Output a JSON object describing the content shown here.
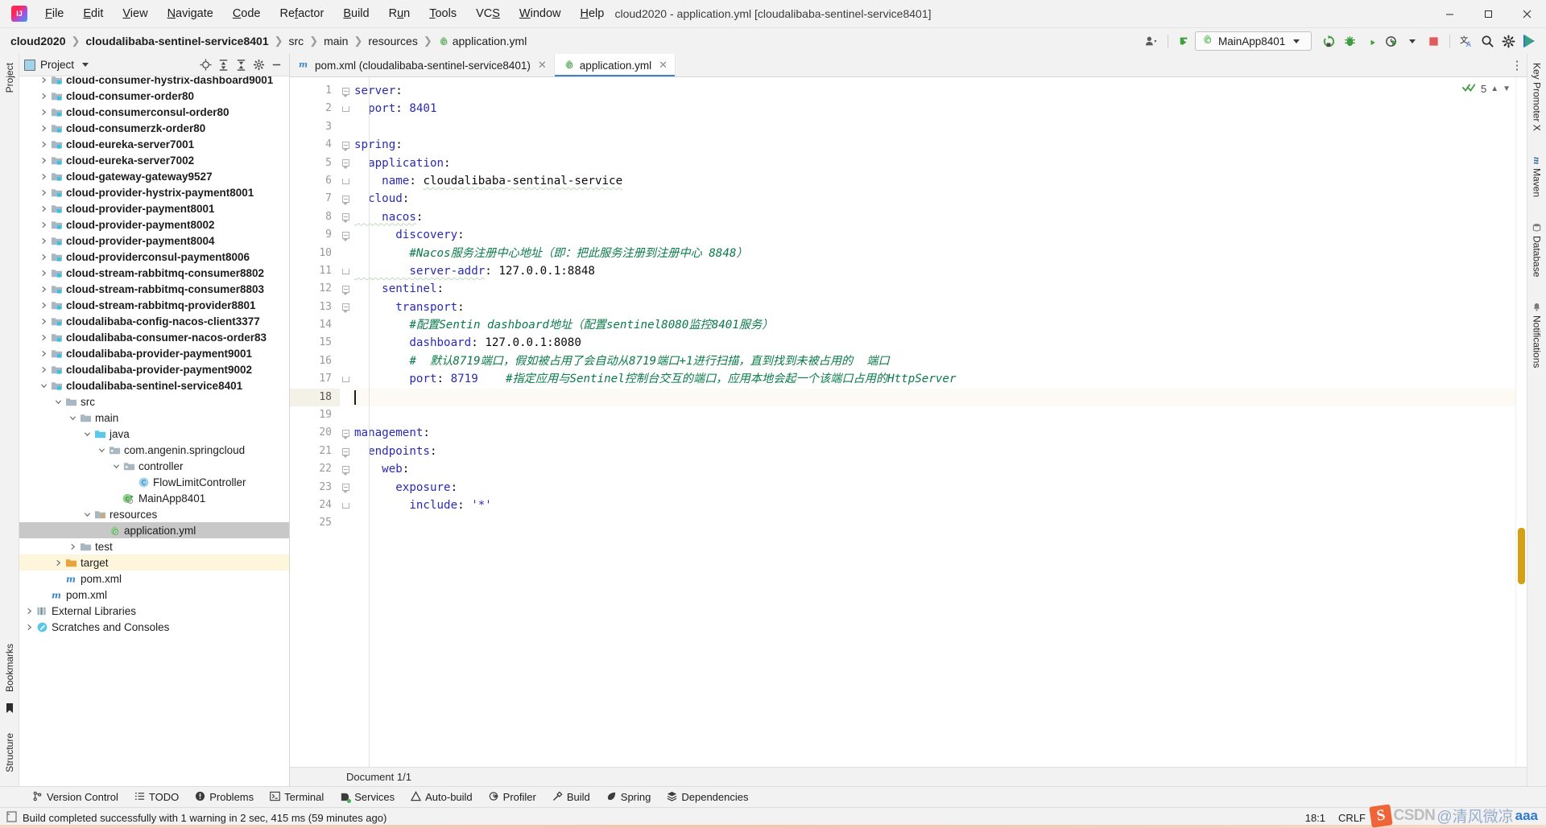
{
  "window": {
    "title": "cloud2020 - application.yml [cloudalibaba-sentinel-service8401]",
    "minimize": "—",
    "maximize": "❐",
    "close": "✕"
  },
  "menubar": {
    "items": [
      {
        "label": "File"
      },
      {
        "label": "Edit"
      },
      {
        "label": "View"
      },
      {
        "label": "Navigate"
      },
      {
        "label": "Code"
      },
      {
        "label": "Refactor"
      },
      {
        "label": "Build"
      },
      {
        "label": "Run"
      },
      {
        "label": "Tools"
      },
      {
        "label": "VCS"
      },
      {
        "label": "Window"
      },
      {
        "label": "Help"
      }
    ]
  },
  "breadcrumbs": [
    {
      "label": "cloud2020",
      "bold": true
    },
    {
      "label": "cloudalibaba-sentinel-service8401",
      "bold": true
    },
    {
      "label": "src",
      "bold": false
    },
    {
      "label": "main",
      "bold": false
    },
    {
      "label": "resources",
      "bold": false
    },
    {
      "label": "application.yml",
      "bold": false,
      "icon": "yml-file-icon"
    }
  ],
  "toolbar": {
    "run_config_name": "MainApp8401",
    "icons": [
      {
        "name": "user-account-icon"
      },
      {
        "name": "vcs-update-icon"
      },
      {
        "name": "rerun-icon"
      },
      {
        "name": "debug-icon"
      },
      {
        "name": "run-with-coverage-icon"
      },
      {
        "name": "profiler-icon"
      },
      {
        "name": "stop-icon"
      },
      {
        "name": "translate-icon"
      },
      {
        "name": "search-everywhere-icon"
      },
      {
        "name": "settings-gear-icon"
      },
      {
        "name": "play-all-icon"
      }
    ]
  },
  "left_rail": {
    "top_label": "Project",
    "bottom_labels": [
      "Bookmarks",
      "Structure"
    ]
  },
  "right_rail": {
    "labels": [
      "Key Promoter X",
      "Maven",
      "Database",
      "Notifications"
    ]
  },
  "project_panel": {
    "title": "Project",
    "header_actions": [
      "locate-icon",
      "expand-all-icon",
      "collapse-all-icon",
      "settings-gear-icon",
      "hide-icon"
    ],
    "tree": [
      {
        "label": "cloud-consumer-hystrix-dashboard9001",
        "depth": 1,
        "twist": "collapsed",
        "icon": "module-folder-icon",
        "bold": true,
        "clipped": true
      },
      {
        "label": "cloud-consumer-order80",
        "depth": 1,
        "twist": "collapsed",
        "icon": "module-folder-icon",
        "bold": true
      },
      {
        "label": "cloud-consumerconsul-order80",
        "depth": 1,
        "twist": "collapsed",
        "icon": "module-folder-icon",
        "bold": true
      },
      {
        "label": "cloud-consumerzk-order80",
        "depth": 1,
        "twist": "collapsed",
        "icon": "module-folder-icon",
        "bold": true
      },
      {
        "label": "cloud-eureka-server7001",
        "depth": 1,
        "twist": "collapsed",
        "icon": "module-folder-icon",
        "bold": true
      },
      {
        "label": "cloud-eureka-server7002",
        "depth": 1,
        "twist": "collapsed",
        "icon": "module-folder-icon",
        "bold": true
      },
      {
        "label": "cloud-gateway-gateway9527",
        "depth": 1,
        "twist": "collapsed",
        "icon": "module-folder-icon",
        "bold": true
      },
      {
        "label": "cloud-provider-hystrix-payment8001",
        "depth": 1,
        "twist": "collapsed",
        "icon": "module-folder-icon",
        "bold": true
      },
      {
        "label": "cloud-provider-payment8001",
        "depth": 1,
        "twist": "collapsed",
        "icon": "module-folder-icon",
        "bold": true
      },
      {
        "label": "cloud-provider-payment8002",
        "depth": 1,
        "twist": "collapsed",
        "icon": "module-folder-icon",
        "bold": true
      },
      {
        "label": "cloud-provider-payment8004",
        "depth": 1,
        "twist": "collapsed",
        "icon": "module-folder-icon",
        "bold": true
      },
      {
        "label": "cloud-providerconsul-payment8006",
        "depth": 1,
        "twist": "collapsed",
        "icon": "module-folder-icon",
        "bold": true
      },
      {
        "label": "cloud-stream-rabbitmq-consumer8802",
        "depth": 1,
        "twist": "collapsed",
        "icon": "module-folder-icon",
        "bold": true
      },
      {
        "label": "cloud-stream-rabbitmq-consumer8803",
        "depth": 1,
        "twist": "collapsed",
        "icon": "module-folder-icon",
        "bold": true
      },
      {
        "label": "cloud-stream-rabbitmq-provider8801",
        "depth": 1,
        "twist": "collapsed",
        "icon": "module-folder-icon",
        "bold": true
      },
      {
        "label": "cloudalibaba-config-nacos-client3377",
        "depth": 1,
        "twist": "collapsed",
        "icon": "module-folder-icon",
        "bold": true
      },
      {
        "label": "cloudalibaba-consumer-nacos-order83",
        "depth": 1,
        "twist": "collapsed",
        "icon": "module-folder-icon",
        "bold": true
      },
      {
        "label": "cloudalibaba-provider-payment9001",
        "depth": 1,
        "twist": "collapsed",
        "icon": "module-folder-icon",
        "bold": true
      },
      {
        "label": "cloudalibaba-provider-payment9002",
        "depth": 1,
        "twist": "collapsed",
        "icon": "module-folder-icon",
        "bold": true
      },
      {
        "label": "cloudalibaba-sentinel-service8401",
        "depth": 1,
        "twist": "expanded",
        "icon": "module-folder-icon",
        "bold": true
      },
      {
        "label": "src",
        "depth": 2,
        "twist": "expanded",
        "icon": "folder-icon",
        "bold": false
      },
      {
        "label": "main",
        "depth": 3,
        "twist": "expanded",
        "icon": "folder-icon",
        "bold": false
      },
      {
        "label": "java",
        "depth": 4,
        "twist": "expanded",
        "icon": "source-root-folder-icon",
        "bold": false
      },
      {
        "label": "com.angenin.springcloud",
        "depth": 5,
        "twist": "expanded",
        "icon": "package-icon",
        "bold": false
      },
      {
        "label": "controller",
        "depth": 6,
        "twist": "expanded",
        "icon": "package-icon",
        "bold": false
      },
      {
        "label": "FlowLimitController",
        "depth": 7,
        "twist": "none",
        "icon": "java-class-icon",
        "bold": false
      },
      {
        "label": "MainApp8401",
        "depth": 6,
        "twist": "none",
        "icon": "spring-boot-class-icon",
        "bold": false
      },
      {
        "label": "resources",
        "depth": 4,
        "twist": "expanded",
        "icon": "resources-root-icon",
        "bold": false
      },
      {
        "label": "application.yml",
        "depth": 5,
        "twist": "none",
        "icon": "yml-file-icon",
        "bold": false,
        "selected": true
      },
      {
        "label": "test",
        "depth": 3,
        "twist": "collapsed",
        "icon": "folder-icon",
        "bold": false
      },
      {
        "label": "target",
        "depth": 2,
        "twist": "collapsed",
        "icon": "target-folder-icon",
        "bold": false,
        "highlight": true
      },
      {
        "label": "pom.xml",
        "depth": 2,
        "twist": "none",
        "icon": "maven-pom-icon",
        "bold": false
      },
      {
        "label": "pom.xml",
        "depth": 1,
        "twist": "none",
        "icon": "maven-pom-icon",
        "bold": false
      },
      {
        "label": "External Libraries",
        "depth": 0,
        "twist": "collapsed",
        "icon": "libraries-icon",
        "bold": false
      },
      {
        "label": "Scratches and Consoles",
        "depth": 0,
        "twist": "collapsed",
        "icon": "scratches-icon",
        "bold": false
      }
    ]
  },
  "editor": {
    "tabs": [
      {
        "label": "pom.xml (cloudalibaba-sentinel-service8401)",
        "icon": "maven-pom-icon",
        "active": false,
        "close": "✕"
      },
      {
        "label": "application.yml",
        "icon": "yml-file-icon",
        "active": true,
        "close": "✕"
      }
    ],
    "inspection": {
      "count": "5",
      "check": "✓✓",
      "up": "▲",
      "down": "▼"
    },
    "document_status": "Document 1/1",
    "lines": [
      {
        "n": 1,
        "fold": "open",
        "tokens": [
          {
            "t": "server",
            "c": "key"
          },
          {
            "t": ":",
            "c": "plain"
          }
        ]
      },
      {
        "n": 2,
        "fold": "end",
        "tokens": [
          {
            "t": "  port",
            "c": "key"
          },
          {
            "t": ": ",
            "c": "plain"
          },
          {
            "t": "8401",
            "c": "num"
          }
        ]
      },
      {
        "n": 3,
        "fold": "",
        "tokens": []
      },
      {
        "n": 4,
        "fold": "open",
        "tokens": [
          {
            "t": "spring",
            "c": "key"
          },
          {
            "t": ":",
            "c": "plain"
          }
        ]
      },
      {
        "n": 5,
        "fold": "open",
        "tokens": [
          {
            "t": "  application",
            "c": "key"
          },
          {
            "t": ":",
            "c": "plain"
          }
        ]
      },
      {
        "n": 6,
        "fold": "end",
        "tokens": [
          {
            "t": "    name",
            "c": "key"
          },
          {
            "t": ": ",
            "c": "plain"
          },
          {
            "t": "cloudalibaba-sentinal-service",
            "c": "squig"
          }
        ]
      },
      {
        "n": 7,
        "fold": "open",
        "tokens": [
          {
            "t": "  cloud",
            "c": "key"
          },
          {
            "t": ":",
            "c": "plain"
          }
        ]
      },
      {
        "n": 8,
        "fold": "open",
        "tokens": [
          {
            "t": "    nacos",
            "c": "keysquig"
          },
          {
            "t": ":",
            "c": "plain"
          }
        ]
      },
      {
        "n": 9,
        "fold": "open",
        "tokens": [
          {
            "t": "      discovery",
            "c": "key"
          },
          {
            "t": ":",
            "c": "plain"
          }
        ]
      },
      {
        "n": 10,
        "fold": "",
        "tokens": [
          {
            "t": "        #Nacos服务注册中心地址（即：把此服务注册到注册中心 8848）",
            "c": "cmt"
          }
        ]
      },
      {
        "n": 11,
        "fold": "end",
        "tokens": [
          {
            "t": "        server-addr",
            "c": "keysquig"
          },
          {
            "t": ": ",
            "c": "plain"
          },
          {
            "t": "127.0.0.1:8848",
            "c": "plain"
          }
        ]
      },
      {
        "n": 12,
        "fold": "open",
        "tokens": [
          {
            "t": "    sentinel",
            "c": "key"
          },
          {
            "t": ":",
            "c": "plain"
          }
        ]
      },
      {
        "n": 13,
        "fold": "open",
        "tokens": [
          {
            "t": "      transport",
            "c": "key"
          },
          {
            "t": ":",
            "c": "plain"
          }
        ]
      },
      {
        "n": 14,
        "fold": "",
        "tokens": [
          {
            "t": "        #配置Sentin dashboard地址（配置sentinel8080监控8401服务）",
            "c": "cmt"
          }
        ]
      },
      {
        "n": 15,
        "fold": "",
        "tokens": [
          {
            "t": "        dashboard",
            "c": "key"
          },
          {
            "t": ": ",
            "c": "plain"
          },
          {
            "t": "127.0.0.1:8080",
            "c": "plain"
          }
        ]
      },
      {
        "n": 16,
        "fold": "",
        "tokens": [
          {
            "t": "        #  默认8719端口，假如被占用了会自动从8719端口+1进行扫描，直到找到未被占用的  端口",
            "c": "cmt"
          }
        ]
      },
      {
        "n": 17,
        "fold": "end",
        "tokens": [
          {
            "t": "        port",
            "c": "key"
          },
          {
            "t": ": ",
            "c": "plain"
          },
          {
            "t": "8719",
            "c": "num"
          },
          {
            "t": "    ",
            "c": "plain"
          },
          {
            "t": "#指定应用与Sentinel控制台交互的端口，应用本地会起一个该端口占用的HttpServer",
            "c": "cmt"
          }
        ]
      },
      {
        "n": 18,
        "fold": "",
        "tokens": [],
        "caret": true
      },
      {
        "n": 19,
        "fold": "",
        "tokens": []
      },
      {
        "n": 20,
        "fold": "open",
        "tokens": [
          {
            "t": "management",
            "c": "key"
          },
          {
            "t": ":",
            "c": "plain"
          }
        ]
      },
      {
        "n": 21,
        "fold": "open",
        "tokens": [
          {
            "t": "  endpoints",
            "c": "key"
          },
          {
            "t": ":",
            "c": "plain"
          }
        ]
      },
      {
        "n": 22,
        "fold": "open",
        "tokens": [
          {
            "t": "    web",
            "c": "key"
          },
          {
            "t": ":",
            "c": "plain"
          }
        ]
      },
      {
        "n": 23,
        "fold": "open",
        "tokens": [
          {
            "t": "      exposure",
            "c": "key"
          },
          {
            "t": ":",
            "c": "plain"
          }
        ]
      },
      {
        "n": 24,
        "fold": "end",
        "tokens": [
          {
            "t": "        include",
            "c": "key"
          },
          {
            "t": ": ",
            "c": "plain"
          },
          {
            "t": "'*'",
            "c": "str"
          }
        ]
      },
      {
        "n": 25,
        "fold": "",
        "tokens": []
      }
    ]
  },
  "toolwindow_bar": {
    "items": [
      {
        "label": "Version Control",
        "icon": "branch-icon"
      },
      {
        "label": "TODO",
        "icon": "todo-list-icon"
      },
      {
        "label": "Problems",
        "icon": "problems-icon"
      },
      {
        "label": "Terminal",
        "icon": "terminal-icon"
      },
      {
        "label": "Services",
        "icon": "services-icon"
      },
      {
        "label": "Auto-build",
        "icon": "auto-build-icon"
      },
      {
        "label": "Profiler",
        "icon": "profiler-icon"
      },
      {
        "label": "Build",
        "icon": "hammer-icon"
      },
      {
        "label": "Spring",
        "icon": "spring-leaf-icon"
      },
      {
        "label": "Dependencies",
        "icon": "dependencies-icon"
      }
    ]
  },
  "statusbar": {
    "message": "Build completed successfully with 1 warning in 2 sec, 415 ms (59 minutes ago)",
    "message_icon": "build-status-icon",
    "caret_position": "18:1",
    "line_separator": "CRLF"
  },
  "watermark": {
    "badge": "S",
    "brand": "CSDN",
    "handle": "@清风微凉",
    "suffix": "aaa"
  },
  "colors": {
    "accent_blue": "#4083c9",
    "keyword_blue": "#2a2ab5",
    "comment_green": "#0b7a4b",
    "selection_gray": "#c8c8c8",
    "caret_line": "#fcfaf2",
    "stop_red": "#e05b5b",
    "run_green": "#3e9c3e"
  }
}
